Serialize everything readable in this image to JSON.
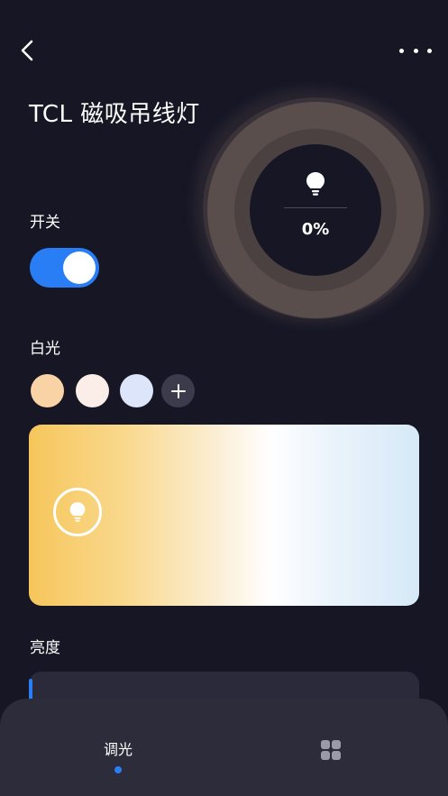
{
  "header": {
    "title": "TCL 磁吸吊线灯",
    "back_icon": "chevron-left-icon",
    "more_icon": "more-horizontal-icon"
  },
  "status_ring": {
    "brightness_percent": "0%",
    "bulb_icon": "lightbulb-icon"
  },
  "power": {
    "label": "开关",
    "on": true,
    "accent_color": "#2a7ef5"
  },
  "white_light": {
    "label": "白光",
    "presets": [
      {
        "name": "warm",
        "color": "#f9d2a5"
      },
      {
        "name": "neutral",
        "color": "#fbeee9"
      },
      {
        "name": "cool",
        "color": "#dde5fb"
      }
    ],
    "add_icon": "plus-icon",
    "handle_icon": "lightbulb-icon",
    "temperature_level": 0.07
  },
  "brightness": {
    "label": "亮度"
  },
  "bottom_nav": {
    "tabs": [
      {
        "label": "调光",
        "active": true
      },
      {
        "icon": "grid-icon",
        "active": false
      }
    ]
  }
}
